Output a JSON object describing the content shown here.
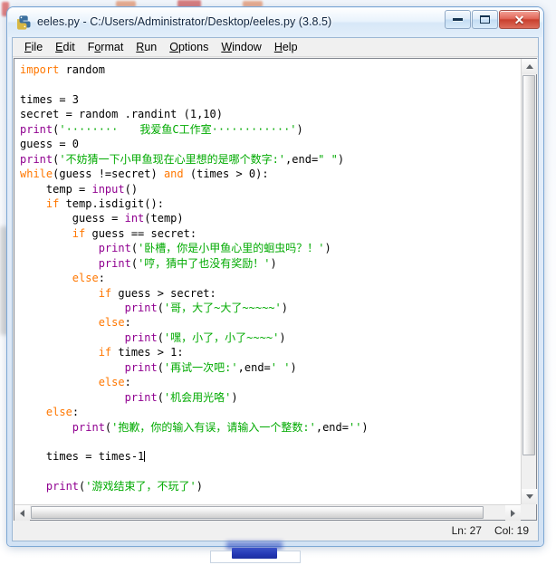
{
  "window": {
    "title": "eeles.py - C:/Users/Administrator/Desktop/eeles.py (3.8.5)",
    "app_icon": "python-idle-icon",
    "controls": {
      "minimize": "minimize-button",
      "maximize": "maximize-button",
      "close_glyph": "✕"
    }
  },
  "menubar": {
    "items": [
      {
        "accel": "F",
        "rest": "ile"
      },
      {
        "accel": "E",
        "rest": "dit"
      },
      {
        "pre": "F",
        "accel": "o",
        "rest": "rmat"
      },
      {
        "accel": "R",
        "rest": "un"
      },
      {
        "accel": "O",
        "rest": "ptions"
      },
      {
        "accel": "W",
        "rest": "indow"
      },
      {
        "accel": "H",
        "rest": "elp"
      }
    ]
  },
  "editor": {
    "language": "python",
    "colors": {
      "keyword": "#ff7700",
      "builtin": "#900090",
      "string": "#00aa00",
      "text": "#000000",
      "background": "#ffffff"
    },
    "lines": [
      [
        {
          "t": "import",
          "c": "kw"
        },
        {
          "t": " random",
          "c": ""
        }
      ],
      [],
      [
        {
          "t": "times = 3",
          "c": ""
        }
      ],
      [
        {
          "t": "secret = random .randint (1,10)",
          "c": ""
        }
      ],
      [
        {
          "t": "print",
          "c": "bi"
        },
        {
          "t": "(",
          "c": ""
        },
        {
          "t": "'········　　我爱鱼C工作室············'",
          "c": "str"
        },
        {
          "t": ")",
          "c": ""
        }
      ],
      [
        {
          "t": "guess = 0",
          "c": ""
        }
      ],
      [
        {
          "t": "print",
          "c": "bi"
        },
        {
          "t": "(",
          "c": ""
        },
        {
          "t": "'不妨猜一下小甲鱼现在心里想的是哪个数字:'",
          "c": "str"
        },
        {
          "t": ",end=",
          "c": ""
        },
        {
          "t": "\" \"",
          "c": "str"
        },
        {
          "t": ")",
          "c": ""
        }
      ],
      [
        {
          "t": "while",
          "c": "kw"
        },
        {
          "t": "(guess !=secret) ",
          "c": ""
        },
        {
          "t": "and",
          "c": "kw"
        },
        {
          "t": " (times > 0):",
          "c": ""
        }
      ],
      [
        {
          "t": "    temp = ",
          "c": ""
        },
        {
          "t": "input",
          "c": "bi"
        },
        {
          "t": "()",
          "c": ""
        }
      ],
      [
        {
          "t": "    ",
          "c": ""
        },
        {
          "t": "if",
          "c": "kw"
        },
        {
          "t": " temp.isdigit():",
          "c": ""
        }
      ],
      [
        {
          "t": "        guess = ",
          "c": ""
        },
        {
          "t": "int",
          "c": "bi"
        },
        {
          "t": "(temp)",
          "c": ""
        }
      ],
      [
        {
          "t": "        ",
          "c": ""
        },
        {
          "t": "if",
          "c": "kw"
        },
        {
          "t": " guess == secret:",
          "c": ""
        }
      ],
      [
        {
          "t": "            ",
          "c": ""
        },
        {
          "t": "print",
          "c": "bi"
        },
        {
          "t": "(",
          "c": ""
        },
        {
          "t": "'卧槽，你是小甲鱼心里的蛔虫吗？！'",
          "c": "str"
        },
        {
          "t": ")",
          "c": ""
        }
      ],
      [
        {
          "t": "            ",
          "c": ""
        },
        {
          "t": "print",
          "c": "bi"
        },
        {
          "t": "(",
          "c": ""
        },
        {
          "t": "'哼，猜中了也没有奖励！'",
          "c": "str"
        },
        {
          "t": ")",
          "c": ""
        }
      ],
      [
        {
          "t": "        ",
          "c": ""
        },
        {
          "t": "else",
          "c": "kw"
        },
        {
          "t": ":",
          "c": ""
        }
      ],
      [
        {
          "t": "            ",
          "c": ""
        },
        {
          "t": "if",
          "c": "kw"
        },
        {
          "t": " guess > secret:",
          "c": ""
        }
      ],
      [
        {
          "t": "                ",
          "c": ""
        },
        {
          "t": "print",
          "c": "bi"
        },
        {
          "t": "(",
          "c": ""
        },
        {
          "t": "'哥，大了~大了~~~~~'",
          "c": "str"
        },
        {
          "t": ")",
          "c": ""
        }
      ],
      [
        {
          "t": "            ",
          "c": ""
        },
        {
          "t": "else",
          "c": "kw"
        },
        {
          "t": ":",
          "c": ""
        }
      ],
      [
        {
          "t": "                ",
          "c": ""
        },
        {
          "t": "print",
          "c": "bi"
        },
        {
          "t": "(",
          "c": ""
        },
        {
          "t": "'嘿，小了，小了~~~~'",
          "c": "str"
        },
        {
          "t": ")",
          "c": ""
        }
      ],
      [
        {
          "t": "            ",
          "c": ""
        },
        {
          "t": "if",
          "c": "kw"
        },
        {
          "t": " times > 1:",
          "c": ""
        }
      ],
      [
        {
          "t": "                ",
          "c": ""
        },
        {
          "t": "print",
          "c": "bi"
        },
        {
          "t": "(",
          "c": ""
        },
        {
          "t": "'再试一次吧:'",
          "c": "str"
        },
        {
          "t": ",end=",
          "c": ""
        },
        {
          "t": "' '",
          "c": "str"
        },
        {
          "t": ")",
          "c": ""
        }
      ],
      [
        {
          "t": "            ",
          "c": ""
        },
        {
          "t": "else",
          "c": "kw"
        },
        {
          "t": ":",
          "c": ""
        }
      ],
      [
        {
          "t": "                ",
          "c": ""
        },
        {
          "t": "print",
          "c": "bi"
        },
        {
          "t": "(",
          "c": ""
        },
        {
          "t": "'机会用光咯'",
          "c": "str"
        },
        {
          "t": ")",
          "c": ""
        }
      ],
      [
        {
          "t": "    ",
          "c": ""
        },
        {
          "t": "else",
          "c": "kw"
        },
        {
          "t": ":",
          "c": ""
        }
      ],
      [
        {
          "t": "        ",
          "c": ""
        },
        {
          "t": "print",
          "c": "bi"
        },
        {
          "t": "(",
          "c": ""
        },
        {
          "t": "'抱歉，你的输入有误，请输入一个整数:'",
          "c": "str"
        },
        {
          "t": ",end=",
          "c": ""
        },
        {
          "t": "''",
          "c": "str"
        },
        {
          "t": ")",
          "c": ""
        }
      ],
      [],
      [
        {
          "t": "    times = times-1",
          "c": ""
        },
        {
          "t": "",
          "c": "caret"
        }
      ],
      [],
      [
        {
          "t": "    ",
          "c": ""
        },
        {
          "t": "print",
          "c": "bi"
        },
        {
          "t": "(",
          "c": ""
        },
        {
          "t": "'游戏结束了，不玩了'",
          "c": "str"
        },
        {
          "t": ")",
          "c": ""
        }
      ]
    ]
  },
  "scrollbars": {
    "vertical": {
      "up_arrow": "scroll-up-icon",
      "down_arrow": "scroll-down-icon"
    },
    "horizontal": {
      "left_arrow": "scroll-left-icon",
      "right_arrow": "scroll-right-icon"
    }
  },
  "statusbar": {
    "line": "Ln: 27",
    "col": "Col: 19"
  }
}
